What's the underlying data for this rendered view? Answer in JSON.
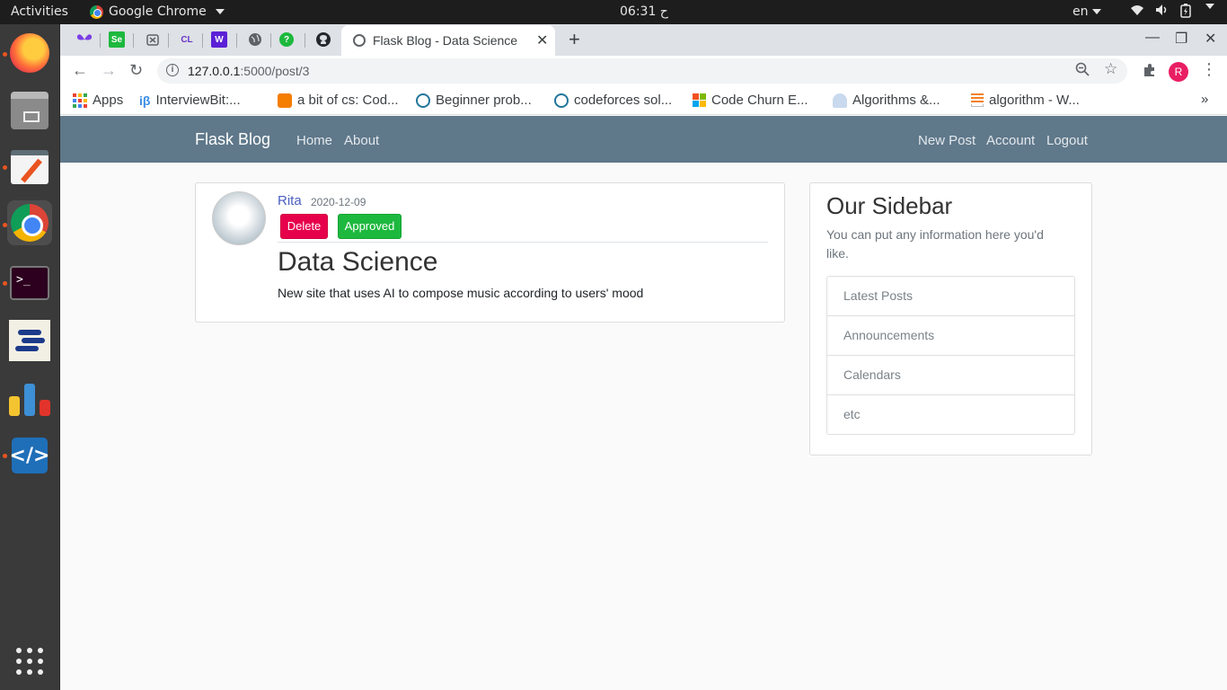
{
  "os": {
    "activities": "Activities",
    "app_name": "Google Chrome",
    "clock": "06:31 ح",
    "lang": "en",
    "tray": [
      "wifi-icon",
      "volume-icon",
      "battery-icon"
    ]
  },
  "dock": {
    "items": [
      "firefox",
      "files",
      "text-editor",
      "chrome",
      "terminal",
      "stack-app",
      "charts-app",
      "vscode",
      "show-apps"
    ],
    "bars_colors": [
      "#f4c430",
      "#3d8fd6",
      "#e2342b"
    ]
  },
  "browser": {
    "tab_title": "Flask Blog - Data Science",
    "url_host": "127.0.0.1",
    "url_rest": ":5000/post/3",
    "profile_initial": "R",
    "bookmarks": [
      {
        "label": "Apps",
        "icon": "apps-icon"
      },
      {
        "label": "InterviewBit:...",
        "icon": "interviewbit-icon"
      },
      {
        "label": "a bit of cs: Cod...",
        "icon": "blogger-icon"
      },
      {
        "label": "Beginner prob...",
        "icon": "wordpress-icon"
      },
      {
        "label": "codeforces sol...",
        "icon": "wordpress-icon"
      },
      {
        "label": "Code Churn E...",
        "icon": "microsoft-icon"
      },
      {
        "label": "Algorithms &...",
        "icon": "algorithms-icon"
      },
      {
        "label": "algorithm - W...",
        "icon": "stackoverflow-icon"
      }
    ],
    "pinned_tab_labels": [
      "",
      "Se",
      "",
      "CL",
      "W",
      "",
      "?",
      ""
    ]
  },
  "navbar": {
    "brand": "Flask Blog",
    "left_links": [
      "Home",
      "About"
    ],
    "right_links": [
      "New Post",
      "Account",
      "Logout"
    ]
  },
  "post": {
    "author": "Rita",
    "date": "2020-12-09",
    "delete_label": "Delete",
    "approved_label": "Approved",
    "title": "Data Science",
    "content": "New site that uses AI to compose music according to users' mood"
  },
  "sidebar": {
    "title": "Our Sidebar",
    "text": "You can put any information here you'd like.",
    "items": [
      "Latest Posts",
      "Announcements",
      "Calendars",
      "etc"
    ]
  },
  "colors": {
    "navbar": "#5f788a",
    "delete": "#e6004c",
    "approved": "#1db83e",
    "author_link": "#4a5fc1"
  }
}
